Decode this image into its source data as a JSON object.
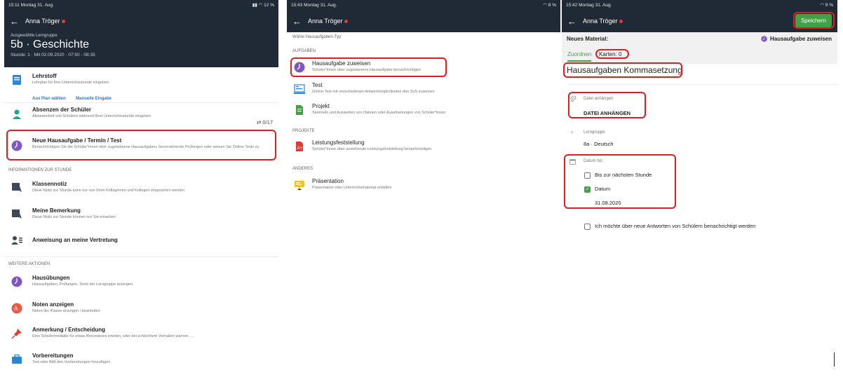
{
  "panel1": {
    "status": {
      "time": "15:11",
      "date": "Montag 31. Aug.",
      "battery": "12 %"
    },
    "nav": {
      "user": "Anna Tröger"
    },
    "hero": {
      "subtitle": "Ausgewählte Lerngruppe",
      "title": "5b · Geschichte",
      "meta": "Stunde: 1 · Mit 02.09.2020 · 07:50 - 08:35"
    },
    "items": [
      {
        "title": "Lehrstoff",
        "desc": "Lehrplan für Ihre Unterrichtsstunde eingeben",
        "link1": "Aus Plan wählen",
        "link2": "Manuelle Eingabe"
      },
      {
        "title": "Absenzen der Schüler",
        "desc": "Abwesenheit von Schülern während Ihrer Unterrichtsstunde eingeben",
        "count": "0/17"
      },
      {
        "title": "Neue Hausaufgabe / Termin / Test",
        "desc": "Benachrichtigen Sie die Schüler*innen über zugewiesene Hausaufgaben, bevorstehende Prüfungen oder weisen Sie Online-Tests zu"
      }
    ],
    "section_info": "Informationen zur Stunde",
    "info_items": [
      {
        "title": "Klassennotiz",
        "desc": "Diese Notiz zur Stunde kann nur von Ihren Kolleginnen und Kollegen eingesehen werden"
      },
      {
        "title": "Meine Bemerkung",
        "desc": "Diese Notiz zur Stunde können nur Sie einsehen"
      },
      {
        "title": "Anweisung an meine Vertretung",
        "desc": ""
      }
    ],
    "section_more": "Weitere Aktionen",
    "more_items": [
      {
        "title": "Hausübungen",
        "desc": "Hausaufgaben, Prüfungen, Tests der Lerngruppe anzeigen"
      },
      {
        "title": "Noten anzeigen",
        "desc": "Noten der Klasse anzeigen / bearbeiten"
      },
      {
        "title": "Anmerkung / Entscheidung",
        "desc": "Eine Schülermedaille für etwas Besonderes erteilen, oder bei schlechtem Verhalten warnen ...."
      },
      {
        "title": "Vorbereitungen",
        "desc": "Text oder Bild den Vorbereitungen hinzufügen"
      }
    ]
  },
  "panel2": {
    "status": {
      "time": "15:43",
      "date": "Montag 31. Aug.",
      "battery": "8 %"
    },
    "nav": {
      "user": "Anna Tröger"
    },
    "header": "Wähle Hausaufgaben-Typ",
    "section_tasks": "Aufgaben",
    "tasks": [
      {
        "title": "Hausaufgabe zuweisen",
        "desc": "Schüler*innen über zugewiesene Hausaufgabe benachrichtigen"
      },
      {
        "title": "Test",
        "desc": "Online-Test mit verschiedenen Antwortmöglichkeiten den SuS zuweisen"
      },
      {
        "title": "Projekt",
        "desc": "Sammeln und Auswerten von Dateien oder Ausarbeitungen von Schüler*innen"
      }
    ],
    "section_projects": "Projekte",
    "projects": [
      {
        "title": "Leistungsfeststellung",
        "desc": "Schüler*innen über anstehende Leistungsfeststellung benachrichtigen"
      }
    ],
    "section_other": "Anderes",
    "other": [
      {
        "title": "Präsentation",
        "desc": "Präsentation oder Unterrichtsmaterial erstellen"
      }
    ]
  },
  "panel3": {
    "status": {
      "time": "15:42",
      "date": "Montag 31. Aug.",
      "battery": "9 %"
    },
    "nav": {
      "user": "Anna Tröger",
      "save": "Speichern"
    },
    "material_label": "Neues Material:",
    "material_type": "Hausaufgabe zuweisen",
    "tab_assign": "Zuordnen",
    "tab_cards": "Karten: 0",
    "title_value": "Hausaufgaben Kommasetzung",
    "attach_label": "Datei anhängen",
    "attach_button": "DATEI ANHÄNGEN",
    "group_label": "Lerngruppe",
    "group_value": "8a · Deutsch",
    "date_label": "Datum bis",
    "option_next": "Bis zur nächsten Stunde",
    "option_date": "Datum",
    "date_value": "31.08.2020",
    "notify": "Ich möchte über neue Antworten von Schülern benachrichtigt werden"
  },
  "colors": {
    "header": "#1f2a36",
    "highlight": "#e01e1e",
    "accent_green": "#43a047",
    "link_blue": "#2b78c5",
    "purple": "#7e57c2"
  }
}
